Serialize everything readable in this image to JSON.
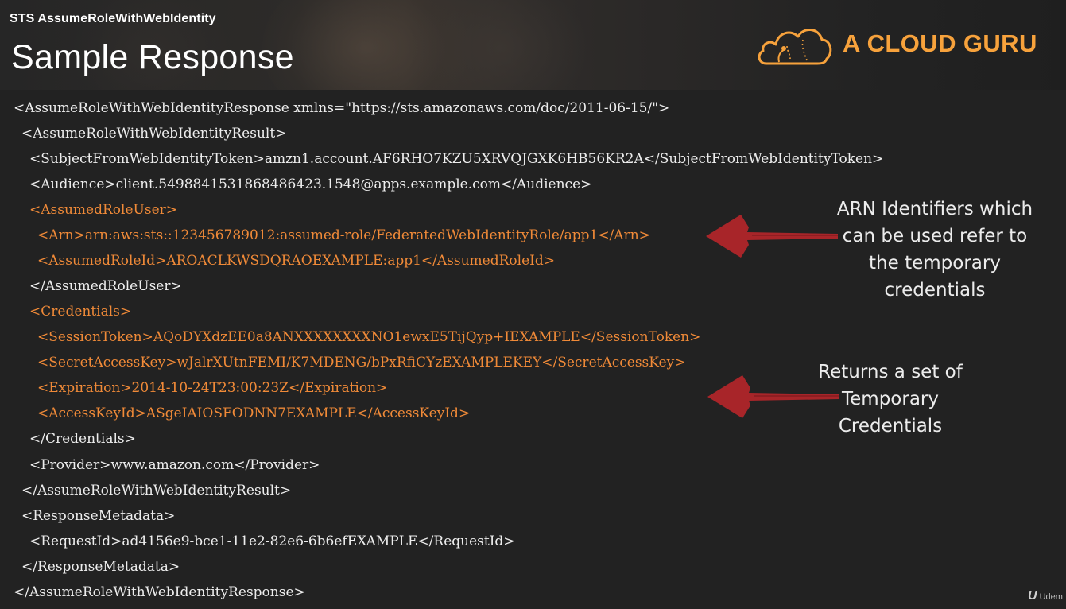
{
  "header": {
    "subtitle": "STS AssumeRoleWithWebIdentity",
    "title": "Sample Response"
  },
  "logo": {
    "text": "A CLOUD GURU",
    "icon": "cloud-icon",
    "color": "#f7a23c"
  },
  "code": {
    "lines": [
      "<AssumeRoleWithWebIdentityResponse xmlns=\"https://sts.amazonaws.com/doc/2011-06-15/\">",
      "<AssumeRoleWithWebIdentityResult>",
      "<SubjectFromWebIdentityToken>amzn1.account.AF6RHO7KZU5XRVQJGXK6HB56KR2A</SubjectFromWebIdentityToken>",
      "<Audience>client.5498841531868486423.1548@apps.example.com</Audience>",
      "<AssumedRoleUser>",
      "<Arn>arn:aws:sts::123456789012:assumed-role/FederatedWebIdentityRole/app1</Arn>",
      "<AssumedRoleId>AROACLKWSDQRAOEXAMPLE:app1</AssumedRoleId>",
      "</AssumedRoleUser>",
      "<Credentials>",
      "<SessionToken>AQoDYXdzEE0a8ANXXXXXXXXNO1ewxE5TijQyp+IEXAMPLE</SessionToken>",
      "<SecretAccessKey>wJalrXUtnFEMI/K7MDENG/bPxRfiCYzEXAMPLEKEY</SecretAccessKey>",
      "<Expiration>2014-10-24T23:00:23Z</Expiration>",
      "<AccessKeyId>ASgeIAIOSFODNN7EXAMPLE</AccessKeyId>",
      "</Credentials>",
      "<Provider>www.amazon.com</Provider>",
      "</AssumeRoleWithWebIdentityResult>",
      "<ResponseMetadata>",
      "<RequestId>ad4156e9-bce1-11e2-82e6-6b6efEXAMPLE</RequestId>",
      "</ResponseMetadata>",
      "</AssumeRoleWithWebIdentityResponse>"
    ],
    "text_color": "#ededed",
    "highlight_color": "#f08a38"
  },
  "annotations": {
    "arn": {
      "lines": [
        "ARN Identifiers which",
        "can be used refer to",
        "the temporary",
        "credentials"
      ]
    },
    "credentials": {
      "lines": [
        "Returns a set of",
        "Temporary",
        "Credentials"
      ]
    },
    "arrow_color": "#b0262a"
  },
  "watermark": {
    "text": "Udem",
    "icon": "udemy-icon"
  }
}
